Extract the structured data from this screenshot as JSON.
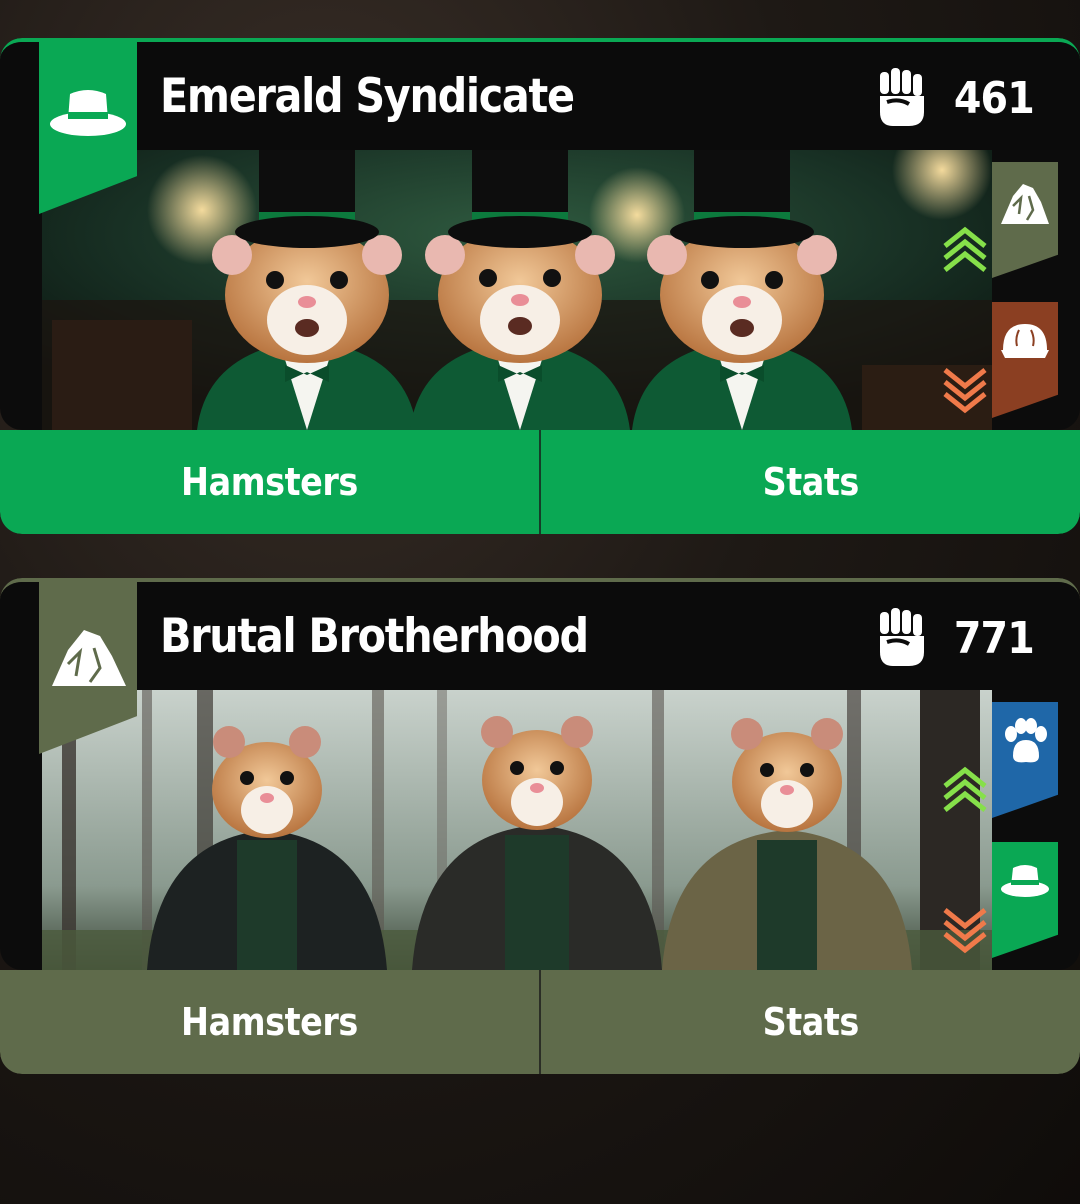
{
  "colors": {
    "emerald": "#0aa854",
    "brutal": "#5f6b4b",
    "up_chevron": "#86e04a",
    "down_chevron": "#f07a4a",
    "tag_brown": "#8b3f22",
    "tag_blue": "#1f67a8"
  },
  "factions": [
    {
      "name": "Emerald Syndicate",
      "power": "461",
      "icon": "hat-icon",
      "accent": "#0aa854",
      "strong_against": {
        "icon": "rock-icon",
        "color": "#5f6b4b"
      },
      "weak_against": {
        "icon": "helmet-icon",
        "color": "#8b3f22"
      },
      "tabs": [
        "Hamsters",
        "Stats"
      ]
    },
    {
      "name": "Brutal Brotherhood",
      "power": "771",
      "icon": "rock-icon",
      "accent": "#5f6b4b",
      "strong_against": {
        "icon": "paw-icon",
        "color": "#1f67a8"
      },
      "weak_against": {
        "icon": "hat-icon",
        "color": "#0aa854"
      },
      "tabs": [
        "Hamsters",
        "Stats"
      ]
    }
  ]
}
